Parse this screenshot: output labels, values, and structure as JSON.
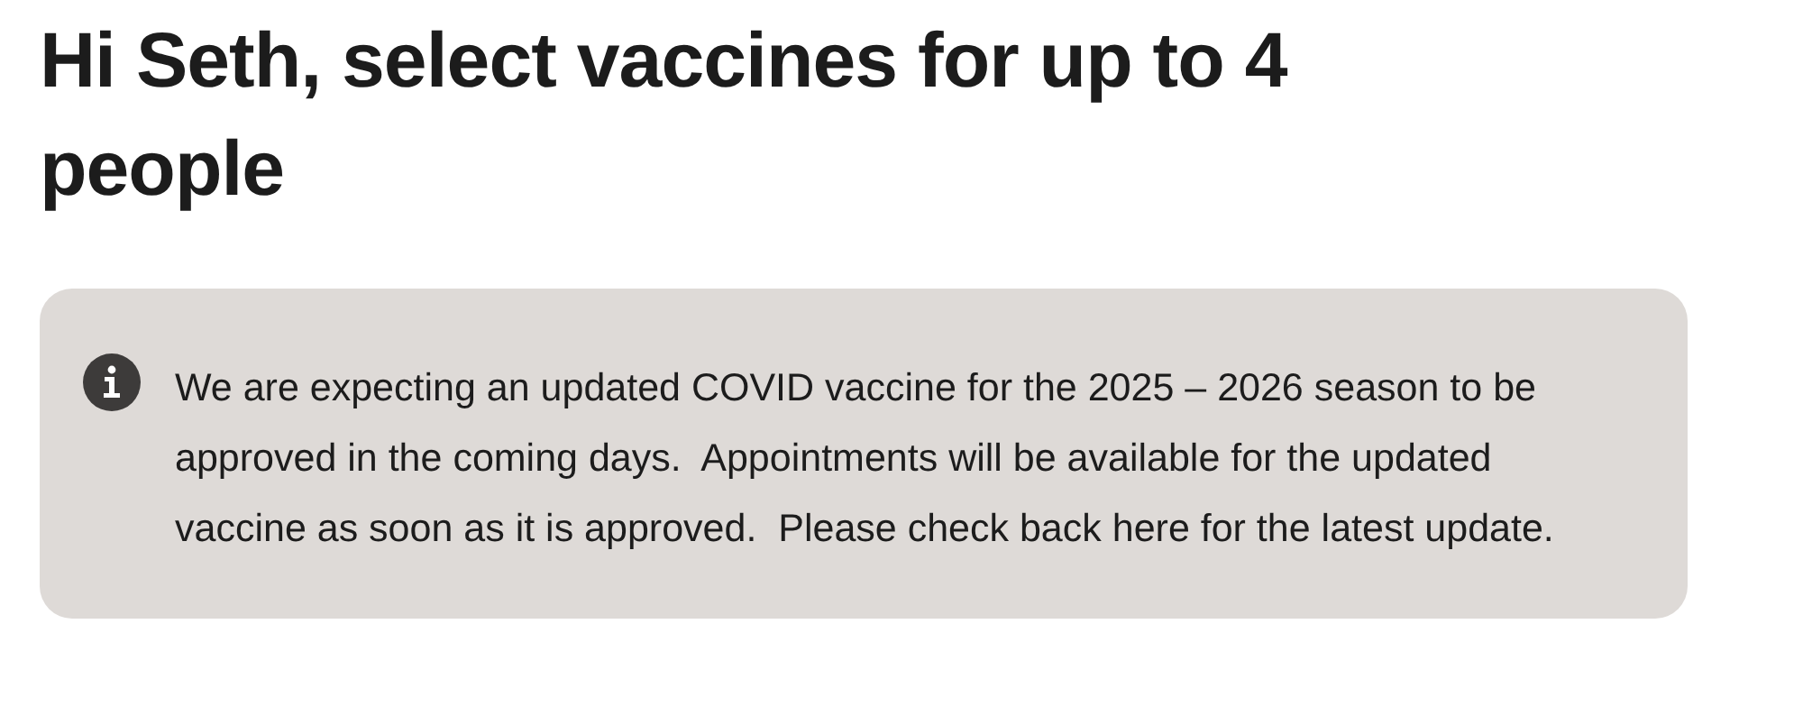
{
  "heading": "Hi Seth, select vaccines for up to 4 people",
  "notice": {
    "text": "We are expecting an updated COVID vaccine for the 2025 – 2026 season to be approved in the coming days.  Appointments will be available for the updated vaccine as soon as it is approved.  Please check back here for the latest update."
  }
}
